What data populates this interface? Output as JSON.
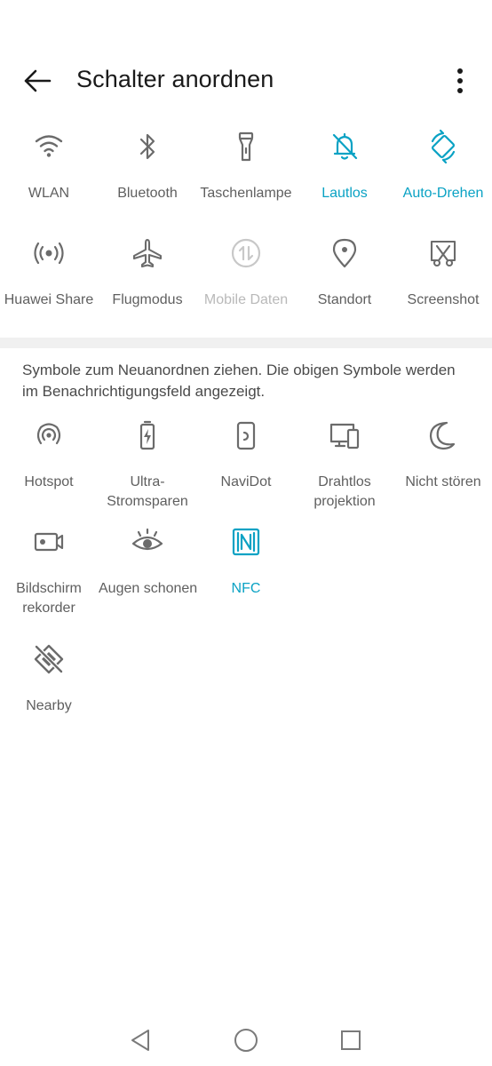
{
  "header": {
    "title": "Schalter anordnen"
  },
  "active_tiles": [
    {
      "label": "WLAN",
      "icon": "wifi-icon",
      "state": "normal"
    },
    {
      "label": "Bluetooth",
      "icon": "bluetooth-icon",
      "state": "normal"
    },
    {
      "label": "Taschenlampe",
      "icon": "flashlight-icon",
      "state": "normal"
    },
    {
      "label": "Lautlos",
      "icon": "bell-off-icon",
      "state": "active"
    },
    {
      "label": "Auto-Drehen",
      "icon": "auto-rotate-icon",
      "state": "active"
    },
    {
      "label": "Huawei Share",
      "icon": "huawei-share-icon",
      "state": "normal"
    },
    {
      "label": "Flugmodus",
      "icon": "airplane-icon",
      "state": "normal"
    },
    {
      "label": "Mobile Daten",
      "icon": "mobile-data-icon",
      "state": "disabled"
    },
    {
      "label": "Standort",
      "icon": "location-pin-icon",
      "state": "normal"
    },
    {
      "label": "Screenshot",
      "icon": "screenshot-icon",
      "state": "normal"
    }
  ],
  "hint": "Symbole zum Neuanordnen ziehen. Die obigen Symbole werden im Benachrichtigungsfeld angezeigt.",
  "available_tiles": [
    {
      "label": "Hotspot",
      "icon": "hotspot-icon",
      "state": "normal"
    },
    {
      "label": "Ultra-\nStromsparen",
      "icon": "battery-saver-icon",
      "state": "normal"
    },
    {
      "label": "NaviDot",
      "icon": "navidot-icon",
      "state": "normal"
    },
    {
      "label": "Drahtlos\nprojektion",
      "icon": "wireless-projection-icon",
      "state": "normal"
    },
    {
      "label": "Nicht stören",
      "icon": "moon-icon",
      "state": "normal"
    },
    {
      "label": "Bildschirm\nrekorder",
      "icon": "screen-recorder-icon",
      "state": "normal"
    },
    {
      "label": "Augen schonen",
      "icon": "eye-icon",
      "state": "normal"
    },
    {
      "label": "NFC",
      "icon": "nfc-icon",
      "state": "active"
    },
    {
      "label": "Nearby",
      "icon": "nearby-icon",
      "state": "normal"
    }
  ],
  "colors": {
    "accent": "#0aa2c4",
    "icon": "#6b6b6b",
    "disabled": "#c8c8c8",
    "text": "#5f5f5f"
  },
  "navbar": {
    "back": "triangle-back-icon",
    "home": "circle-home-icon",
    "recents": "square-recents-icon"
  }
}
